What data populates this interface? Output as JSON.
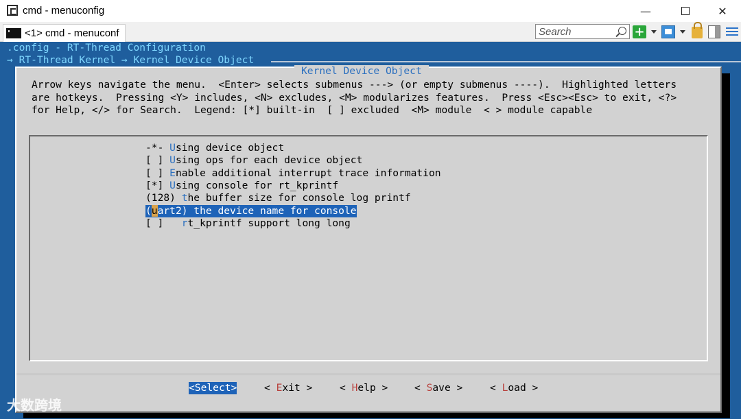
{
  "window": {
    "title": "cmd - menuconfig",
    "minimize": "—",
    "close": "✕"
  },
  "tab": {
    "label": "<1> cmd - menuconf"
  },
  "search": {
    "placeholder": "Search"
  },
  "console": {
    "config_line": ".config - RT-Thread Configuration",
    "breadcrumb": "→ RT-Thread Kernel → Kernel Device Object"
  },
  "dialog": {
    "title": "Kernel Device Object",
    "help_lines": [
      "Arrow keys navigate the menu.  <Enter> selects submenus ---> (or empty submenus ----).  Highlighted letters",
      "are hotkeys.  Pressing <Y> includes, <N> excludes, <M> modularizes features.  Press <Esc><Esc> to exit, <?>",
      "for Help, </> for Search.  Legend: [*] built-in  [ ] excluded  <M> module  < > module capable"
    ]
  },
  "menu": {
    "items": [
      {
        "prefix": "-*- ",
        "hotkey": "U",
        "rest": "sing device object"
      },
      {
        "prefix": "[ ] ",
        "hotkey": "U",
        "rest": "sing ops for each device object"
      },
      {
        "prefix": "[ ] ",
        "hotkey": "E",
        "rest": "nable additional interrupt trace information"
      },
      {
        "prefix": "[*] ",
        "hotkey": "U",
        "rest": "sing console for rt_kprintf"
      },
      {
        "prefix": "(128) ",
        "hotkey": "t",
        "rest": "he buffer size for console log printf"
      },
      {
        "prefix": "(",
        "hotkey": "u",
        "rest": "art2) the device name for console"
      },
      {
        "prefix": "[ ]   ",
        "hotkey": "r",
        "rest": "t_kprintf support long long"
      }
    ],
    "selected_index": 5
  },
  "buttons": [
    {
      "pre": "<",
      "hotkey": "S",
      "rest": "elect>"
    },
    {
      "pre": "< ",
      "hotkey": "E",
      "rest": "xit >"
    },
    {
      "pre": "< ",
      "hotkey": "H",
      "rest": "elp >"
    },
    {
      "pre": "< ",
      "hotkey": "S",
      "rest": "ave >"
    },
    {
      "pre": "< ",
      "hotkey": "L",
      "rest": "oad >"
    }
  ],
  "watermark": "大数跨境",
  "colors": {
    "console_bg": "#1f5e9d",
    "dialog_bg": "#d2d2d2",
    "selection": "#1e63b8",
    "hotkey_blue": "#2a6fbf",
    "button_hotkey": "#b8403c"
  }
}
